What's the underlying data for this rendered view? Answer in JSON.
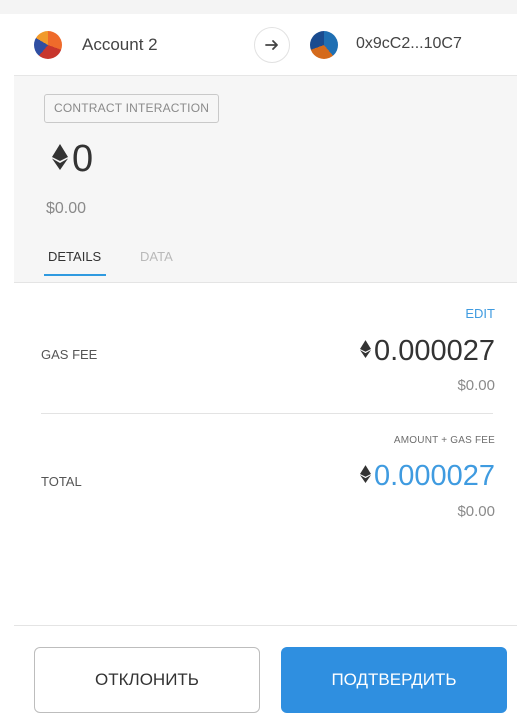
{
  "header": {
    "from_account": "Account 2",
    "to_address": "0x9cC2...10C7",
    "arrow_icon": "arrow-right-icon"
  },
  "summary": {
    "method": "CONTRACT INTERACTION",
    "amount": "0",
    "amount_fiat": "$0.00",
    "currency_icon": "eth-icon",
    "tabs": [
      {
        "label": "DETAILS",
        "active": true
      },
      {
        "label": "DATA",
        "active": false
      }
    ]
  },
  "details": {
    "edit_label": "EDIT",
    "gas_fee": {
      "label": "GAS FEE",
      "value": "0.000027",
      "fiat": "$0.00"
    },
    "total": {
      "heading": "AMOUNT + GAS FEE",
      "label": "TOTAL",
      "value": "0.000027",
      "fiat": "$0.00"
    }
  },
  "footer": {
    "reject_label": "ОТКЛОНИТЬ",
    "confirm_label": "ПОДТВЕРДИТЬ"
  },
  "colors": {
    "accent": "#3f9be0",
    "confirm_bg": "#2f8fe0",
    "summary_bg": "#f6f6f6"
  }
}
